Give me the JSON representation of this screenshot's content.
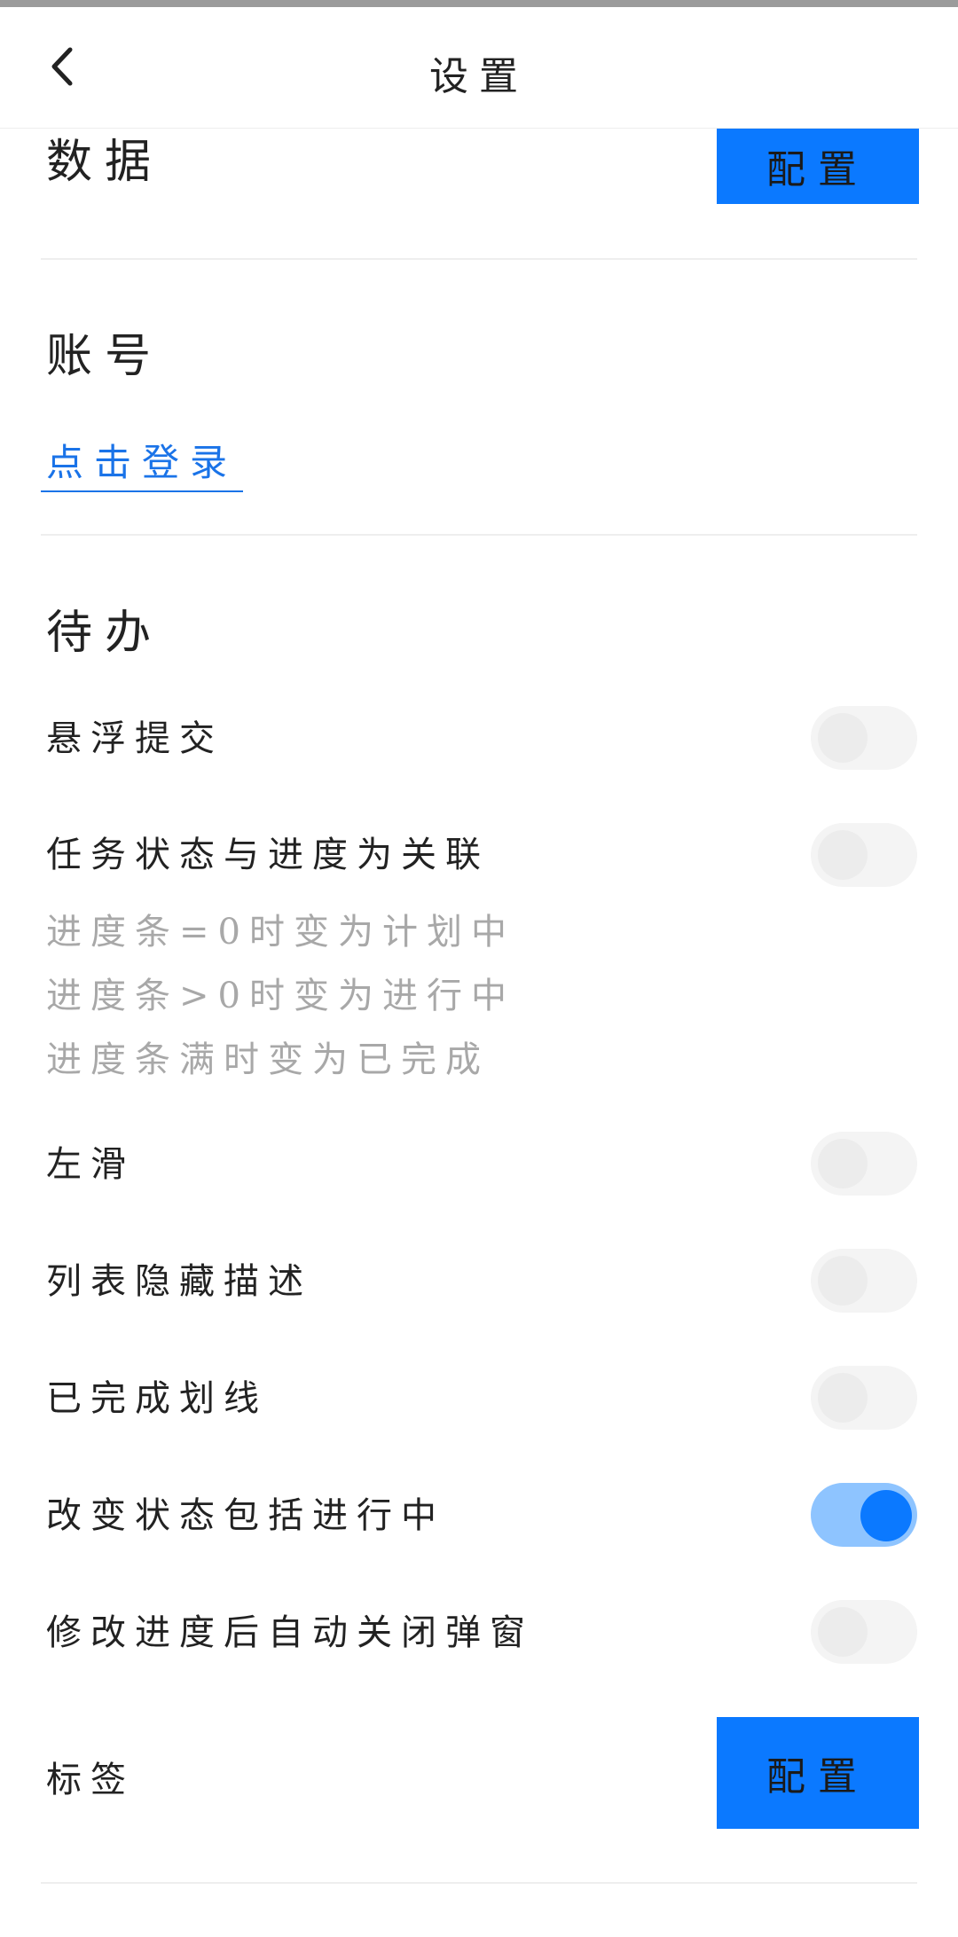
{
  "header": {
    "title": "设置",
    "back_icon": "chevron-left-icon"
  },
  "sections": {
    "data": {
      "title": "数据",
      "config_label": "配置"
    },
    "account": {
      "title": "账号",
      "login_link": "点击登录"
    },
    "todo": {
      "title": "待办",
      "rows": [
        {
          "label": "悬浮提交",
          "on": false
        },
        {
          "label": "任务状态与进度为关联",
          "on": false,
          "hints": [
            "进度条=0时变为计划中",
            "进度条>0时变为进行中",
            "进度条满时变为已完成"
          ]
        },
        {
          "label": "左滑",
          "on": false
        },
        {
          "label": "列表隐藏描述",
          "on": false
        },
        {
          "label": "已完成划线",
          "on": false
        },
        {
          "label": "改变状态包括进行中",
          "on": true
        },
        {
          "label": "修改进度后自动关闭弹窗",
          "on": false
        }
      ]
    },
    "tags": {
      "title": "标签",
      "config_label": "配置"
    }
  },
  "colors": {
    "accent": "#0b79ff",
    "toggle_on_track": "#8ec4ff",
    "link": "#1a73e8"
  }
}
